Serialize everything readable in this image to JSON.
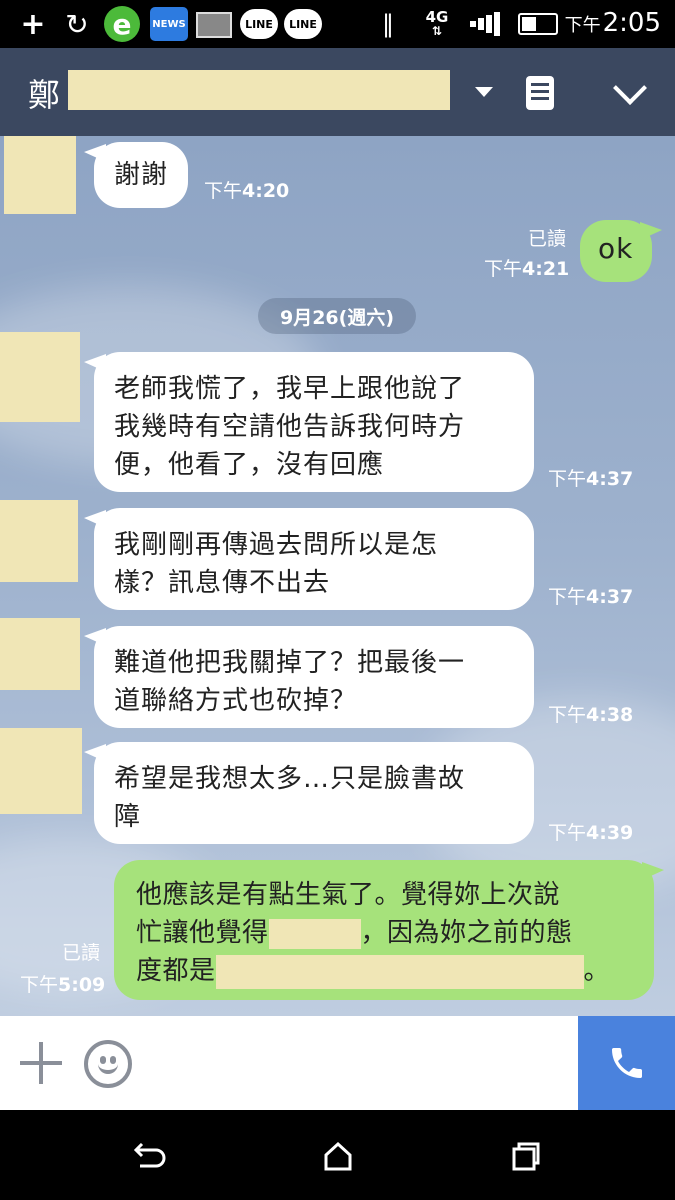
{
  "status_bar": {
    "news_label": "NEWS",
    "line_label": "LINE",
    "network": "4G",
    "time_ampm": "下午",
    "time": "2:05"
  },
  "header": {
    "contact_name_visible": "鄭"
  },
  "chat": {
    "date_divider": "9月26(週六)",
    "messages": [
      {
        "direction": "in",
        "text": "謝謝",
        "time_ampm": "下午",
        "time": "4:20"
      },
      {
        "direction": "out",
        "text": "ok",
        "read_label": "已讀",
        "time_ampm": "下午",
        "time": "4:21"
      },
      {
        "direction": "in",
        "lines": [
          "老師我慌了，我早上跟他說了",
          "我幾時有空請他告訴我何時方",
          "便，他看了，沒有回應"
        ],
        "time_ampm": "下午",
        "time": "4:37"
      },
      {
        "direction": "in",
        "lines": [
          "我剛剛再傳過去問所以是怎",
          "樣？訊息傳不出去"
        ],
        "time_ampm": "下午",
        "time": "4:37"
      },
      {
        "direction": "in",
        "lines": [
          "難道他把我關掉了？把最後一",
          "道聯絡方式也砍掉？"
        ],
        "time_ampm": "下午",
        "time": "4:38"
      },
      {
        "direction": "in",
        "lines": [
          "希望是我想太多…只是臉書故",
          "障"
        ],
        "time_ampm": "下午",
        "time": "4:39"
      },
      {
        "direction": "out",
        "line1": "他應該是有點生氣了。覺得妳上次說",
        "line2_pre": "忙讓他覺得",
        "line2_post": "，因為妳之前的態",
        "line3_pre": "度都是",
        "line3_post": "。",
        "read_label": "已讀",
        "time_ampm": "下午",
        "time": "5:09"
      }
    ]
  },
  "colors": {
    "header_bg": "#3b4860",
    "outgoing_bubble": "#a6e27b",
    "incoming_bubble": "#ffffff",
    "call_button": "#4a82dd",
    "redaction": "#f0e6b6"
  }
}
